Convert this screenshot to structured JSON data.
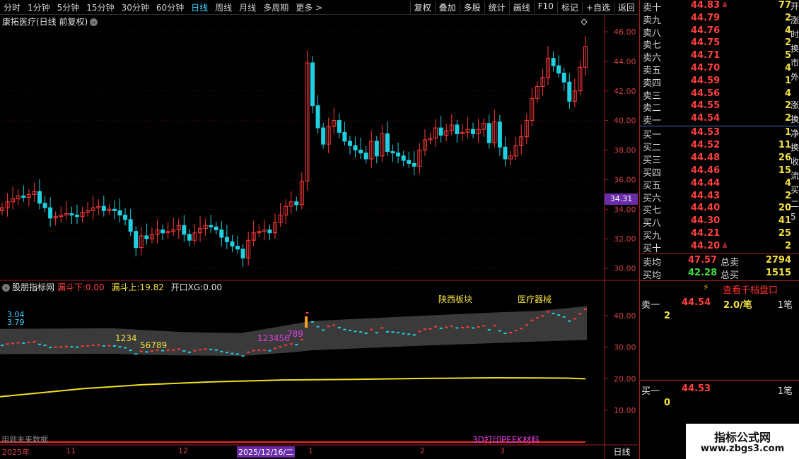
{
  "toolbar": {
    "left_tabs": [
      "分时",
      "1分钟",
      "5分钟",
      "15分钟",
      "30分钟",
      "60分钟",
      "日线",
      "周线",
      "月线",
      "多周期",
      "更多 >"
    ],
    "active_tab": "日线",
    "right_buttons": [
      "复权",
      "叠加",
      "多股",
      "统计",
      "画线",
      "F10",
      "标记",
      "+自选",
      "返回"
    ]
  },
  "main_chart": {
    "stock_title": "康拓医疗(日线 前复权)",
    "y_ticks": [
      "46.00",
      "44.00",
      "42.00",
      "40.00",
      "38.00",
      "36.00",
      "34.00",
      "32.00",
      "30.00"
    ],
    "current_price_tag": "34.31"
  },
  "indicator": {
    "name": "股朋指标网",
    "param1_label": "漏斗下:",
    "param1_value": "0.00",
    "param2_label": "漏斗上:",
    "param2_value": "19.82",
    "param3_label": "开口XG:",
    "param3_value": "0.00",
    "left_value_1": "3.04",
    "left_value_2": "3.79",
    "seq_yellow_1": "1234",
    "seq_yellow_2": "56789",
    "seq_pink_1": "123456",
    "seq_pink_2": "789",
    "label_sector": "陕西板块",
    "label_industry": "医疗器械",
    "label_bottom": "3D打印PEEK材料",
    "y_ticks": [
      "40.00",
      "30.00",
      "20.00",
      "10.00"
    ],
    "note": "用到未来数据"
  },
  "date_axis": {
    "labels": [
      "2025年",
      "11",
      "12",
      "2025/12/16/二",
      "1",
      "2",
      "3"
    ],
    "period": "日线"
  },
  "orderbook": {
    "asks": [
      {
        "label": "卖十",
        "price": "44.83",
        "vol": "77"
      },
      {
        "label": "卖九",
        "price": "44.79",
        "vol": "2"
      },
      {
        "label": "卖八",
        "price": "44.76",
        "vol": "4"
      },
      {
        "label": "卖七",
        "price": "44.75",
        "vol": "2"
      },
      {
        "label": "卖六",
        "price": "44.71",
        "vol": "5"
      },
      {
        "label": "卖五",
        "price": "44.70",
        "vol": "4"
      },
      {
        "label": "卖四",
        "price": "44.59",
        "vol": "1"
      },
      {
        "label": "卖三",
        "price": "44.56",
        "vol": "4"
      },
      {
        "label": "卖二",
        "price": "44.55",
        "vol": "2"
      },
      {
        "label": "卖一",
        "price": "44.54",
        "vol": "2"
      }
    ],
    "bids": [
      {
        "label": "买一",
        "price": "44.53",
        "vol": "1"
      },
      {
        "label": "买二",
        "price": "44.52",
        "vol": "11"
      },
      {
        "label": "买三",
        "price": "44.48",
        "vol": "26"
      },
      {
        "label": "买四",
        "price": "44.46",
        "vol": "15"
      },
      {
        "label": "买五",
        "price": "44.44",
        "vol": "4"
      },
      {
        "label": "买六",
        "price": "44.43",
        "vol": "2"
      },
      {
        "label": "买七",
        "price": "44.40",
        "vol": "20"
      },
      {
        "label": "买八",
        "price": "44.30",
        "vol": "41"
      },
      {
        "label": "买九",
        "price": "44.21",
        "vol": "25"
      },
      {
        "label": "买十",
        "price": "44.20",
        "vol": "2"
      }
    ],
    "ask_avg_label": "卖均",
    "ask_avg": "47.57",
    "total_sell_label": "总卖",
    "total_sell": "2794",
    "bid_avg_label": "买均",
    "bid_avg": "42.28",
    "total_buy_label": "总买",
    "total_buy": "1515",
    "deep_button": "查看千档盘口",
    "sell1_label": "卖一",
    "sell1_price": "44.54",
    "sell1_per": "2.0/笔",
    "sell1_count": "1笔",
    "sell1_queue": "2",
    "buy1_label": "买一",
    "buy1_price": "44.53",
    "buy1_count": "1笔",
    "buy1_queue": "0",
    "cut_chars": [
      "开",
      "涨",
      "时",
      "换",
      "市",
      "外",
      "",
      "涨",
      "换",
      "净",
      "换",
      "收",
      "流",
      "买",
      "二",
      "5"
    ]
  },
  "watermark": {
    "line1": "指标公式网",
    "line2": "www.zbgs3.com"
  },
  "colors": {
    "up": "#ff3b3b",
    "down": "#20d0e0",
    "ma": "#f0e020",
    "accent": "#3cd2ff",
    "purple": "#6a2ca8"
  }
}
